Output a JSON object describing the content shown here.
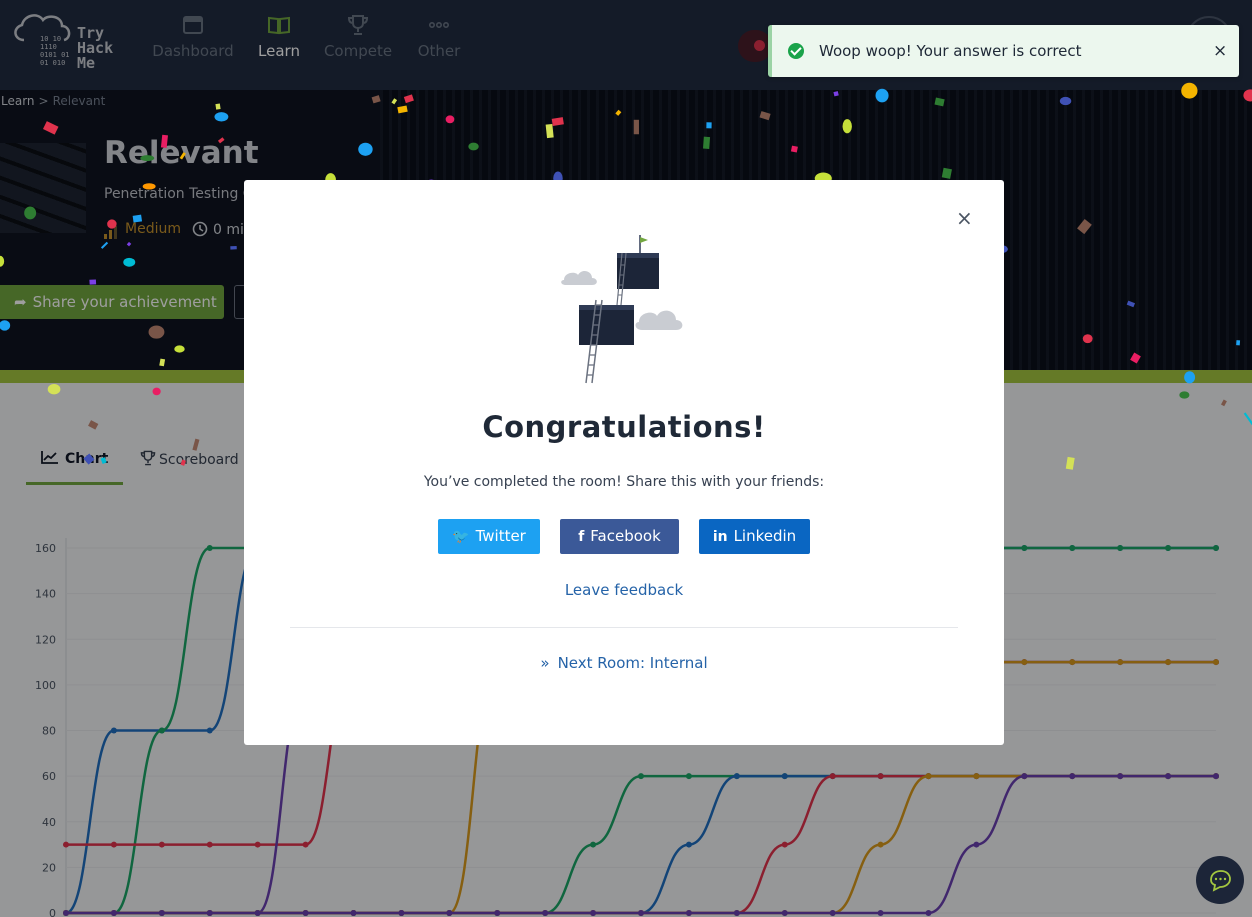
{
  "nav": {
    "logo_lines": [
      "Try",
      "Hack",
      "Me"
    ],
    "logo_binary": [
      "10  10",
      "1110",
      "0101  01",
      "01  010"
    ],
    "items": [
      {
        "label": "Dashboard",
        "icon": "browser-window-icon",
        "active": false
      },
      {
        "label": "Learn",
        "icon": "open-book-icon",
        "active": true
      },
      {
        "label": "Compete",
        "icon": "trophy-icon",
        "active": false
      },
      {
        "label": "Other",
        "icon": "more-dots-icon",
        "active": false
      }
    ]
  },
  "toast": {
    "message": "Woop woop! Your answer is correct",
    "close": "×",
    "icon": "check-circle-icon"
  },
  "breadcrumb": {
    "root": "Learn",
    "sep": ">",
    "current": "Relevant"
  },
  "room": {
    "title": "Relevant",
    "subtitle": "Penetration Testing C",
    "difficulty": "Medium",
    "time": "0 mi",
    "share_label": "Share your achievement"
  },
  "tabs": [
    {
      "label": "Chart",
      "icon": "line-chart-icon",
      "active": true
    },
    {
      "label": "Scoreboard",
      "icon": "trophy-icon",
      "active": false
    }
  ],
  "modal": {
    "close": "×",
    "title": "Congratulations!",
    "message": "You’ve completed the room! Share this with your friends:",
    "twitter": "Twitter",
    "facebook": "Facebook",
    "linkedin": "Linkedin",
    "feedback": "Leave feedback",
    "next_room": "Next Room: Internal"
  },
  "colors": {
    "nav_bg": "#212c42",
    "accent_green": "#72a640",
    "twitter": "#1da1f2",
    "facebook": "#3b5998",
    "linkedin": "#0a66c2",
    "link": "#2563a8"
  },
  "chart_data": {
    "type": "line",
    "ylim": [
      0,
      160
    ],
    "yticks": [
      0,
      20,
      40,
      60,
      80,
      100,
      120,
      140,
      160
    ],
    "grid": true,
    "x_count": 25,
    "series": [
      {
        "color": "#1f6fc0",
        "values": [
          0,
          80,
          80,
          80,
          160,
          160,
          160,
          160,
          160,
          160,
          160,
          160,
          160,
          160,
          160,
          160,
          160,
          160,
          160,
          160,
          160,
          160,
          160,
          160,
          160
        ]
      },
      {
        "color": "#1aa566",
        "values": [
          0,
          0,
          80,
          160,
          160,
          160,
          160,
          160,
          160,
          160,
          160,
          160,
          160,
          160,
          160,
          160,
          160,
          160,
          160,
          160,
          160,
          160,
          160,
          160,
          160
        ]
      },
      {
        "color": "#e0334d",
        "values": [
          30,
          30,
          30,
          30,
          30,
          30,
          110,
          110,
          110,
          110,
          110,
          110,
          110,
          110,
          110,
          110,
          110,
          110,
          110,
          110,
          110,
          110,
          110,
          110,
          110
        ]
      },
      {
        "color": "#6a3fb0",
        "values": [
          0,
          0,
          0,
          0,
          0,
          100,
          110,
          110,
          110,
          110,
          110,
          110,
          110,
          110,
          110,
          110,
          110,
          110,
          110,
          110,
          110,
          110,
          110,
          110,
          110
        ]
      },
      {
        "color": "#d99a1c",
        "values": [
          0,
          0,
          0,
          0,
          0,
          0,
          0,
          0,
          0,
          110,
          110,
          110,
          110,
          110,
          110,
          110,
          110,
          110,
          110,
          110,
          110,
          110,
          110,
          110,
          110
        ]
      },
      {
        "color": "#1aa566",
        "values": [
          0,
          0,
          0,
          0,
          0,
          0,
          0,
          0,
          0,
          0,
          0,
          30,
          60,
          60,
          60,
          60,
          60,
          60,
          60,
          60,
          60,
          60,
          60,
          60,
          60
        ]
      },
      {
        "color": "#1f6fc0",
        "values": [
          0,
          0,
          0,
          0,
          0,
          0,
          0,
          0,
          0,
          0,
          0,
          0,
          0,
          30,
          60,
          60,
          60,
          60,
          60,
          60,
          60,
          60,
          60,
          60,
          60
        ]
      },
      {
        "color": "#e0334d",
        "values": [
          0,
          0,
          0,
          0,
          0,
          0,
          0,
          0,
          0,
          0,
          0,
          0,
          0,
          0,
          0,
          30,
          60,
          60,
          60,
          60,
          60,
          60,
          60,
          60,
          60
        ]
      },
      {
        "color": "#d99a1c",
        "values": [
          0,
          0,
          0,
          0,
          0,
          0,
          0,
          0,
          0,
          0,
          0,
          0,
          0,
          0,
          0,
          0,
          0,
          30,
          60,
          60,
          60,
          60,
          60,
          60,
          60
        ]
      },
      {
        "color": "#6a3fb0",
        "values": [
          0,
          0,
          0,
          0,
          0,
          0,
          0,
          0,
          0,
          0,
          0,
          0,
          0,
          0,
          0,
          0,
          0,
          0,
          0,
          30,
          60,
          60,
          60,
          60,
          60
        ]
      }
    ]
  }
}
